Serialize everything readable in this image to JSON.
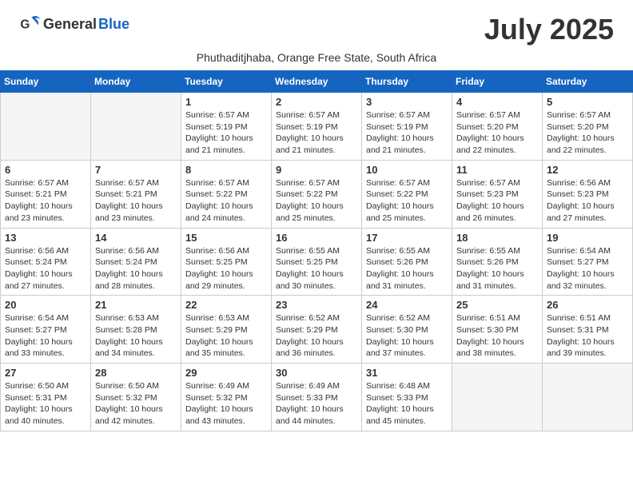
{
  "header": {
    "logo_general": "General",
    "logo_blue": "Blue",
    "month_title": "July 2025",
    "subtitle": "Phuthaditjhaba, Orange Free State, South Africa"
  },
  "weekdays": [
    "Sunday",
    "Monday",
    "Tuesday",
    "Wednesday",
    "Thursday",
    "Friday",
    "Saturday"
  ],
  "weeks": [
    [
      {
        "day": "",
        "sunrise": "",
        "sunset": "",
        "daylight": ""
      },
      {
        "day": "",
        "sunrise": "",
        "sunset": "",
        "daylight": ""
      },
      {
        "day": "1",
        "sunrise": "Sunrise: 6:57 AM",
        "sunset": "Sunset: 5:19 PM",
        "daylight": "Daylight: 10 hours and 21 minutes."
      },
      {
        "day": "2",
        "sunrise": "Sunrise: 6:57 AM",
        "sunset": "Sunset: 5:19 PM",
        "daylight": "Daylight: 10 hours and 21 minutes."
      },
      {
        "day": "3",
        "sunrise": "Sunrise: 6:57 AM",
        "sunset": "Sunset: 5:19 PM",
        "daylight": "Daylight: 10 hours and 21 minutes."
      },
      {
        "day": "4",
        "sunrise": "Sunrise: 6:57 AM",
        "sunset": "Sunset: 5:20 PM",
        "daylight": "Daylight: 10 hours and 22 minutes."
      },
      {
        "day": "5",
        "sunrise": "Sunrise: 6:57 AM",
        "sunset": "Sunset: 5:20 PM",
        "daylight": "Daylight: 10 hours and 22 minutes."
      }
    ],
    [
      {
        "day": "6",
        "sunrise": "Sunrise: 6:57 AM",
        "sunset": "Sunset: 5:21 PM",
        "daylight": "Daylight: 10 hours and 23 minutes."
      },
      {
        "day": "7",
        "sunrise": "Sunrise: 6:57 AM",
        "sunset": "Sunset: 5:21 PM",
        "daylight": "Daylight: 10 hours and 23 minutes."
      },
      {
        "day": "8",
        "sunrise": "Sunrise: 6:57 AM",
        "sunset": "Sunset: 5:22 PM",
        "daylight": "Daylight: 10 hours and 24 minutes."
      },
      {
        "day": "9",
        "sunrise": "Sunrise: 6:57 AM",
        "sunset": "Sunset: 5:22 PM",
        "daylight": "Daylight: 10 hours and 25 minutes."
      },
      {
        "day": "10",
        "sunrise": "Sunrise: 6:57 AM",
        "sunset": "Sunset: 5:22 PM",
        "daylight": "Daylight: 10 hours and 25 minutes."
      },
      {
        "day": "11",
        "sunrise": "Sunrise: 6:57 AM",
        "sunset": "Sunset: 5:23 PM",
        "daylight": "Daylight: 10 hours and 26 minutes."
      },
      {
        "day": "12",
        "sunrise": "Sunrise: 6:56 AM",
        "sunset": "Sunset: 5:23 PM",
        "daylight": "Daylight: 10 hours and 27 minutes."
      }
    ],
    [
      {
        "day": "13",
        "sunrise": "Sunrise: 6:56 AM",
        "sunset": "Sunset: 5:24 PM",
        "daylight": "Daylight: 10 hours and 27 minutes."
      },
      {
        "day": "14",
        "sunrise": "Sunrise: 6:56 AM",
        "sunset": "Sunset: 5:24 PM",
        "daylight": "Daylight: 10 hours and 28 minutes."
      },
      {
        "day": "15",
        "sunrise": "Sunrise: 6:56 AM",
        "sunset": "Sunset: 5:25 PM",
        "daylight": "Daylight: 10 hours and 29 minutes."
      },
      {
        "day": "16",
        "sunrise": "Sunrise: 6:55 AM",
        "sunset": "Sunset: 5:25 PM",
        "daylight": "Daylight: 10 hours and 30 minutes."
      },
      {
        "day": "17",
        "sunrise": "Sunrise: 6:55 AM",
        "sunset": "Sunset: 5:26 PM",
        "daylight": "Daylight: 10 hours and 31 minutes."
      },
      {
        "day": "18",
        "sunrise": "Sunrise: 6:55 AM",
        "sunset": "Sunset: 5:26 PM",
        "daylight": "Daylight: 10 hours and 31 minutes."
      },
      {
        "day": "19",
        "sunrise": "Sunrise: 6:54 AM",
        "sunset": "Sunset: 5:27 PM",
        "daylight": "Daylight: 10 hours and 32 minutes."
      }
    ],
    [
      {
        "day": "20",
        "sunrise": "Sunrise: 6:54 AM",
        "sunset": "Sunset: 5:27 PM",
        "daylight": "Daylight: 10 hours and 33 minutes."
      },
      {
        "day": "21",
        "sunrise": "Sunrise: 6:53 AM",
        "sunset": "Sunset: 5:28 PM",
        "daylight": "Daylight: 10 hours and 34 minutes."
      },
      {
        "day": "22",
        "sunrise": "Sunrise: 6:53 AM",
        "sunset": "Sunset: 5:29 PM",
        "daylight": "Daylight: 10 hours and 35 minutes."
      },
      {
        "day": "23",
        "sunrise": "Sunrise: 6:52 AM",
        "sunset": "Sunset: 5:29 PM",
        "daylight": "Daylight: 10 hours and 36 minutes."
      },
      {
        "day": "24",
        "sunrise": "Sunrise: 6:52 AM",
        "sunset": "Sunset: 5:30 PM",
        "daylight": "Daylight: 10 hours and 37 minutes."
      },
      {
        "day": "25",
        "sunrise": "Sunrise: 6:51 AM",
        "sunset": "Sunset: 5:30 PM",
        "daylight": "Daylight: 10 hours and 38 minutes."
      },
      {
        "day": "26",
        "sunrise": "Sunrise: 6:51 AM",
        "sunset": "Sunset: 5:31 PM",
        "daylight": "Daylight: 10 hours and 39 minutes."
      }
    ],
    [
      {
        "day": "27",
        "sunrise": "Sunrise: 6:50 AM",
        "sunset": "Sunset: 5:31 PM",
        "daylight": "Daylight: 10 hours and 40 minutes."
      },
      {
        "day": "28",
        "sunrise": "Sunrise: 6:50 AM",
        "sunset": "Sunset: 5:32 PM",
        "daylight": "Daylight: 10 hours and 42 minutes."
      },
      {
        "day": "29",
        "sunrise": "Sunrise: 6:49 AM",
        "sunset": "Sunset: 5:32 PM",
        "daylight": "Daylight: 10 hours and 43 minutes."
      },
      {
        "day": "30",
        "sunrise": "Sunrise: 6:49 AM",
        "sunset": "Sunset: 5:33 PM",
        "daylight": "Daylight: 10 hours and 44 minutes."
      },
      {
        "day": "31",
        "sunrise": "Sunrise: 6:48 AM",
        "sunset": "Sunset: 5:33 PM",
        "daylight": "Daylight: 10 hours and 45 minutes."
      },
      {
        "day": "",
        "sunrise": "",
        "sunset": "",
        "daylight": ""
      },
      {
        "day": "",
        "sunrise": "",
        "sunset": "",
        "daylight": ""
      }
    ]
  ]
}
